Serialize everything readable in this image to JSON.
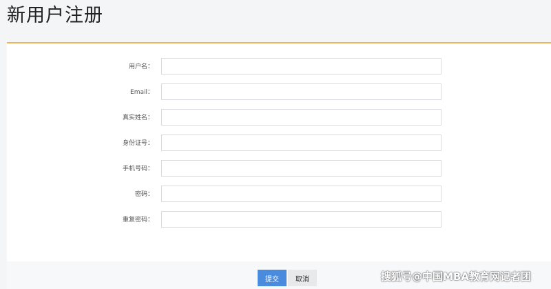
{
  "page": {
    "title": "新用户注册"
  },
  "form": {
    "fields": [
      {
        "label": "用户名：",
        "value": ""
      },
      {
        "label": "Email：",
        "value": ""
      },
      {
        "label": "真实姓名：",
        "value": ""
      },
      {
        "label": "身份证号：",
        "value": ""
      },
      {
        "label": "手机号码：",
        "value": ""
      },
      {
        "label": "密码：",
        "value": ""
      },
      {
        "label": "重复密码：",
        "value": ""
      }
    ]
  },
  "actions": {
    "submit_label": "提交",
    "cancel_label": "取消"
  },
  "watermark": {
    "text": "搜狐号@中国MBA教育网记者团"
  },
  "colors": {
    "accent_line": "#f0b35a",
    "submit_bg": "#4a8bdd",
    "cancel_bg": "#e8e9eb"
  }
}
